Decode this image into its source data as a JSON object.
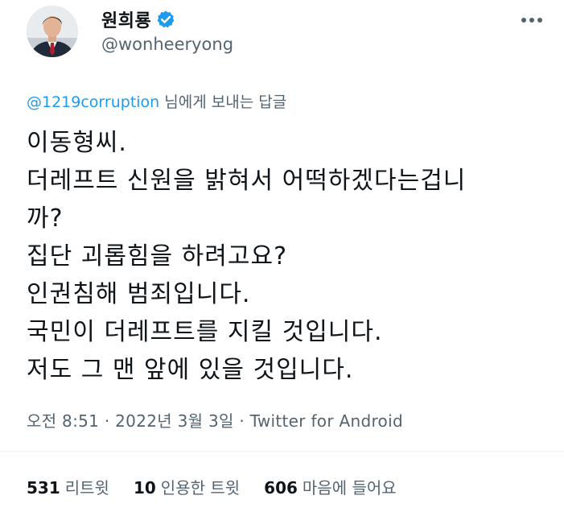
{
  "user": {
    "display_name": "원희룡",
    "handle": "@wonheeryong",
    "verified": true,
    "avatar_icon": "profile-photo"
  },
  "reply": {
    "mention": "@1219corruption",
    "suffix": " 님에게 보내는 답글"
  },
  "tweet": {
    "lines": [
      "이동형씨.",
      "더레프트 신원을 밝혀서 어떡하겠다는겁니",
      "까?",
      "집단 괴롭힘을 하려고요?",
      "인권침해 범죄입니다.",
      "국민이 더레프트를 지킬 것입니다.",
      "저도 그 맨 앞에 있을 것입니다."
    ]
  },
  "meta": {
    "text": "오전 8:51 · 2022년 3월 3일 · Twitter for Android"
  },
  "stats": {
    "retweets_count": "531",
    "retweets_label": "리트윗",
    "quotes_count": "10",
    "quotes_label": "인용한 트윗",
    "likes_count": "606",
    "likes_label": "마음에 들어요"
  },
  "colors": {
    "text_primary": "#0f1419",
    "text_secondary": "#536471",
    "accent": "#1d9bf0",
    "divider": "#eff3f4"
  }
}
